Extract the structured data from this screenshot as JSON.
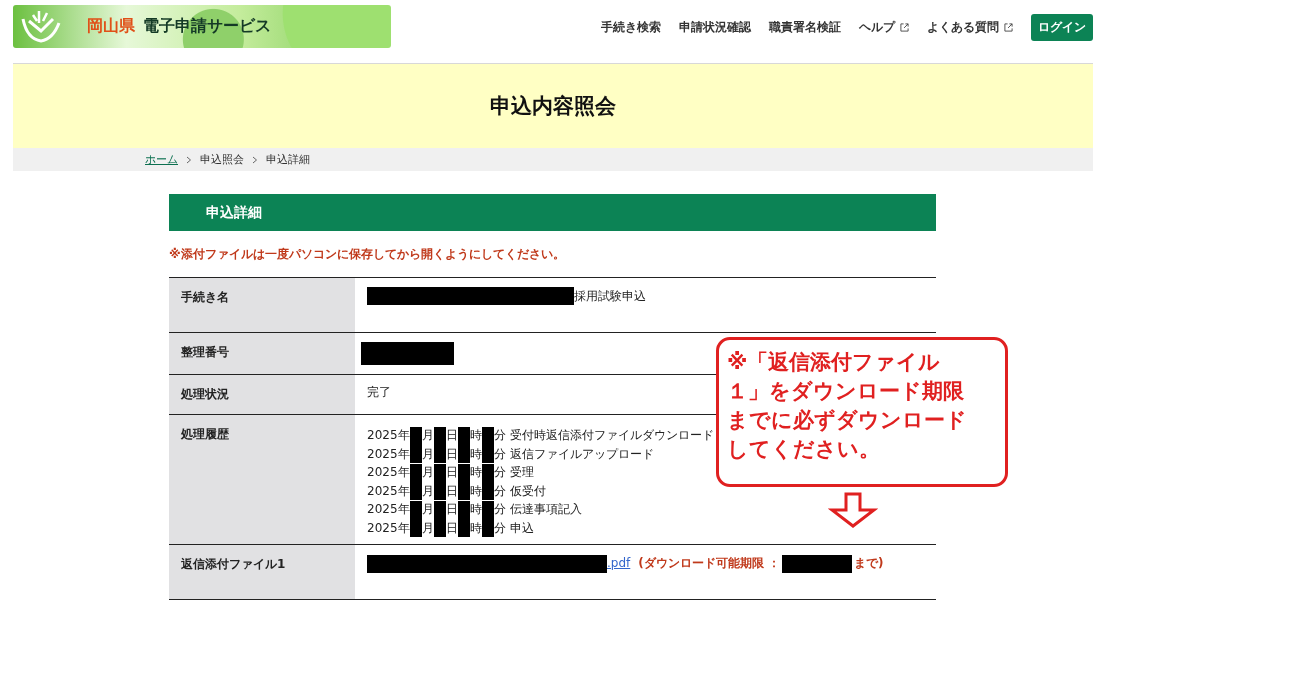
{
  "header": {
    "logo": {
      "prefecture": "岡山県",
      "service": "電子申請サービス"
    },
    "nav": [
      {
        "label": "手続き検索",
        "external": false
      },
      {
        "label": "申請状況確認",
        "external": false
      },
      {
        "label": "職責署名検証",
        "external": false
      },
      {
        "label": "ヘルプ",
        "external": true
      },
      {
        "label": "よくある質問",
        "external": true
      }
    ],
    "login": "ログイン"
  },
  "page_title": "申込内容照会",
  "breadcrumb": [
    {
      "label": "ホーム",
      "link": true
    },
    {
      "label": "申込照会",
      "link": false
    },
    {
      "label": "申込詳細",
      "link": false
    }
  ],
  "section": {
    "title": "申込詳細",
    "notice": "※添付ファイルは一度パソコンに保存してから開くようにしてください。",
    "rows": [
      {
        "kind": "text",
        "label": "手続き名",
        "redacted": true,
        "value": "採用試験申込"
      },
      {
        "kind": "text",
        "label": "整理番号",
        "redacted": true
      },
      {
        "kind": "text",
        "label": "処理状況",
        "redacted": false,
        "value": "完了"
      },
      {
        "kind": "history",
        "label": "処理履歴",
        "entries": [
          {
            "parts": [
              "2025年",
              "月",
              "日",
              "時",
              "分"
            ],
            "event": "受付時返信添付ファイルダウンロード"
          },
          {
            "parts": [
              "2025年",
              "月",
              "日",
              "時",
              "分"
            ],
            "event": "返信ファイルアップロード"
          },
          {
            "parts": [
              "2025年",
              "月",
              "日",
              "時",
              "分"
            ],
            "event": "受理"
          },
          {
            "parts": [
              "2025年",
              "月",
              "日",
              "時",
              "分"
            ],
            "event": "仮受付"
          },
          {
            "parts": [
              "2025年",
              "月",
              "日",
              "時",
              "分"
            ],
            "event": "伝達事項記入"
          },
          {
            "parts": [
              "2025年",
              "月",
              "日",
              "時",
              "分"
            ],
            "event": "申込"
          }
        ]
      },
      {
        "kind": "file",
        "label": "返信添付ファイル1",
        "file_suffix": ".pdf",
        "deadline_prefix": "(ダウンロード可能期限 ：",
        "deadline_suffix": "まで)"
      }
    ]
  },
  "callout": {
    "lines": [
      "※「返信添付ファイル",
      "１」をダウンロード期限",
      "までに必ずダウンロード",
      "してください。"
    ]
  }
}
